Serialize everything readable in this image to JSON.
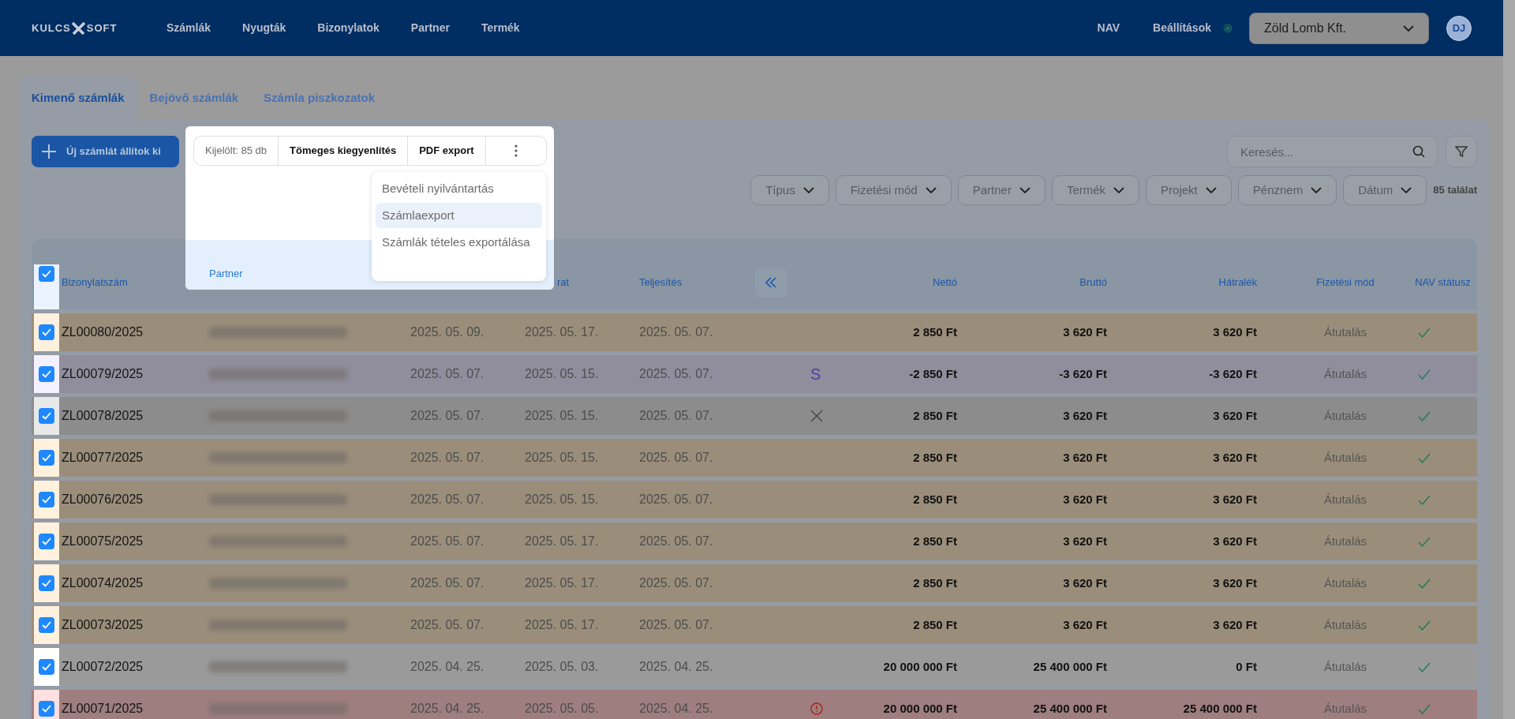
{
  "header": {
    "logo": {
      "left": "KULCS",
      "right": "SOFT"
    },
    "nav": [
      "Számlák",
      "Nyugták",
      "Bizonylatok",
      "Partner",
      "Termék"
    ],
    "right_links": [
      "NAV",
      "Beállítások"
    ],
    "company_select": {
      "value": "Zöld Lomb Kft."
    },
    "avatar": "DJ"
  },
  "tabs": [
    {
      "label": "Kimenő számlák",
      "selected": true
    },
    {
      "label": "Bejövő számlák",
      "selected": false
    },
    {
      "label": "Számla piszkozatok",
      "selected": false
    }
  ],
  "new_button": "Új számlát állítok ki",
  "bulk_bar": {
    "selected_count": "Kijelölt: 85 db",
    "actions": [
      "Tömeges kiegyenlítés",
      "PDF export"
    ],
    "menu": [
      {
        "label": "Bevételi nyilvántartás",
        "highlighted": false
      },
      {
        "label": "Számlaexport",
        "highlighted": true
      },
      {
        "label": "Számlák tételes exportálása",
        "highlighted": false
      }
    ]
  },
  "search": {
    "placeholder": "Keresés..."
  },
  "filters": [
    "Típus",
    "Fizetési mód",
    "Partner",
    "Termék",
    "Projekt",
    "Pénznem",
    "Dátum"
  ],
  "result_count": "85 találat",
  "table": {
    "all_checked": true,
    "columns": [
      "Bizonylatszám",
      "Partner",
      "rat",
      "Teljesítés",
      "Nettó",
      "Bruttó",
      "Hátralék",
      "Fizetési mód",
      "NAV státusz"
    ],
    "rows": [
      {
        "number": "ZL00080/2025",
        "dates": [
          "2025. 05. 09.",
          "2025. 05. 17.",
          "2025. 05. 07."
        ],
        "kind": "open",
        "net": "2 850 Ft",
        "gross": "3 620 Ft",
        "due": "3 620 Ft",
        "payment": "Átutalás",
        "nav_ok": true,
        "checked": true
      },
      {
        "number": "ZL00079/2025",
        "dates": [
          "2025. 05. 07.",
          "2025. 05. 15.",
          "2025. 05. 07."
        ],
        "kind": "credit",
        "flag": "S",
        "net": "-2 850 Ft",
        "gross": "-3 620 Ft",
        "due": "-3 620 Ft",
        "payment": "Átutalás",
        "nav_ok": true,
        "checked": true
      },
      {
        "number": "ZL00078/2025",
        "dates": [
          "2025. 05. 07.",
          "2025. 05. 15.",
          "2025. 05. 07."
        ],
        "kind": "cancelled",
        "net": "2 850 Ft",
        "gross": "3 620 Ft",
        "due": "3 620 Ft",
        "payment": "Átutalás",
        "nav_ok": true,
        "checked": true
      },
      {
        "number": "ZL00077/2025",
        "dates": [
          "2025. 05. 07.",
          "2025. 05. 15.",
          "2025. 05. 07."
        ],
        "kind": "open",
        "net": "2 850 Ft",
        "gross": "3 620 Ft",
        "due": "3 620 Ft",
        "payment": "Átutalás",
        "nav_ok": true,
        "checked": true
      },
      {
        "number": "ZL00076/2025",
        "dates": [
          "2025. 05. 07.",
          "2025. 05. 15.",
          "2025. 05. 07."
        ],
        "kind": "open",
        "net": "2 850 Ft",
        "gross": "3 620 Ft",
        "due": "3 620 Ft",
        "payment": "Átutalás",
        "nav_ok": true,
        "checked": true
      },
      {
        "number": "ZL00075/2025",
        "dates": [
          "2025. 05. 07.",
          "2025. 05. 17.",
          "2025. 05. 07."
        ],
        "kind": "open",
        "net": "2 850 Ft",
        "gross": "3 620 Ft",
        "due": "3 620 Ft",
        "payment": "Átutalás",
        "nav_ok": true,
        "checked": true
      },
      {
        "number": "ZL00074/2025",
        "dates": [
          "2025. 05. 07.",
          "2025. 05. 17.",
          "2025. 05. 07."
        ],
        "kind": "open",
        "net": "2 850 Ft",
        "gross": "3 620 Ft",
        "due": "3 620 Ft",
        "payment": "Átutalás",
        "nav_ok": true,
        "checked": true
      },
      {
        "number": "ZL00073/2025",
        "dates": [
          "2025. 05. 07.",
          "2025. 05. 17.",
          "2025. 05. 07."
        ],
        "kind": "open",
        "net": "2 850 Ft",
        "gross": "3 620 Ft",
        "due": "3 620 Ft",
        "payment": "Átutalás",
        "nav_ok": true,
        "checked": true
      },
      {
        "number": "ZL00072/2025",
        "dates": [
          "2025. 04. 25.",
          "2025. 05. 03.",
          "2025. 04. 25."
        ],
        "kind": "paid",
        "net": "20 000 000 Ft",
        "gross": "25 400 000 Ft",
        "due": "0 Ft",
        "payment": "Átutalás",
        "nav_ok": true,
        "checked": true
      },
      {
        "number": "ZL00071/2025",
        "dates": [
          "2025. 04. 25.",
          "2025. 05. 05.",
          "2025. 04. 25."
        ],
        "kind": "overdue",
        "net": "20 000 000 Ft",
        "gross": "25 400 000 Ft",
        "due": "25 400 000 Ft",
        "payment": "Átutalás",
        "nav_ok": true,
        "checked": true
      }
    ]
  }
}
